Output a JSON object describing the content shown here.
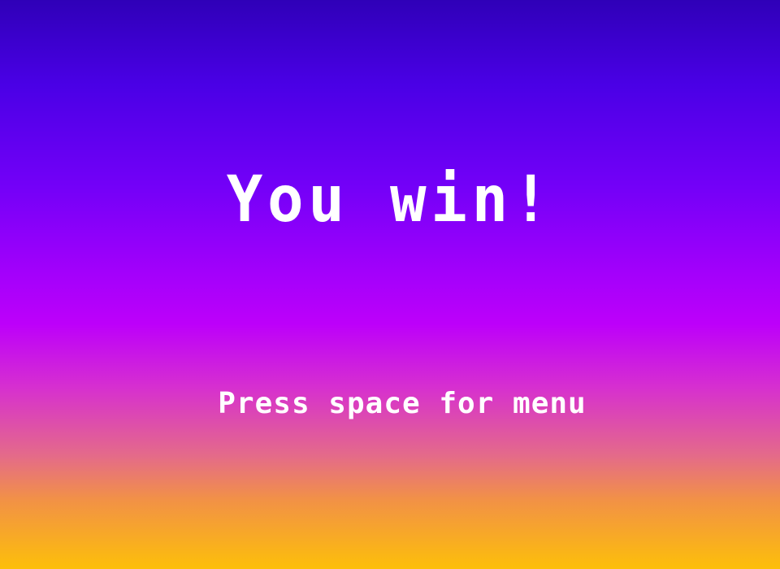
{
  "screen": {
    "title": "You win!",
    "prompt": "Press space for menu"
  },
  "colors": {
    "gradient_top": "#2f00b8",
    "gradient_mid": "#bd00fa",
    "gradient_bottom": "#fdbf0a",
    "text": "#ffffff"
  }
}
